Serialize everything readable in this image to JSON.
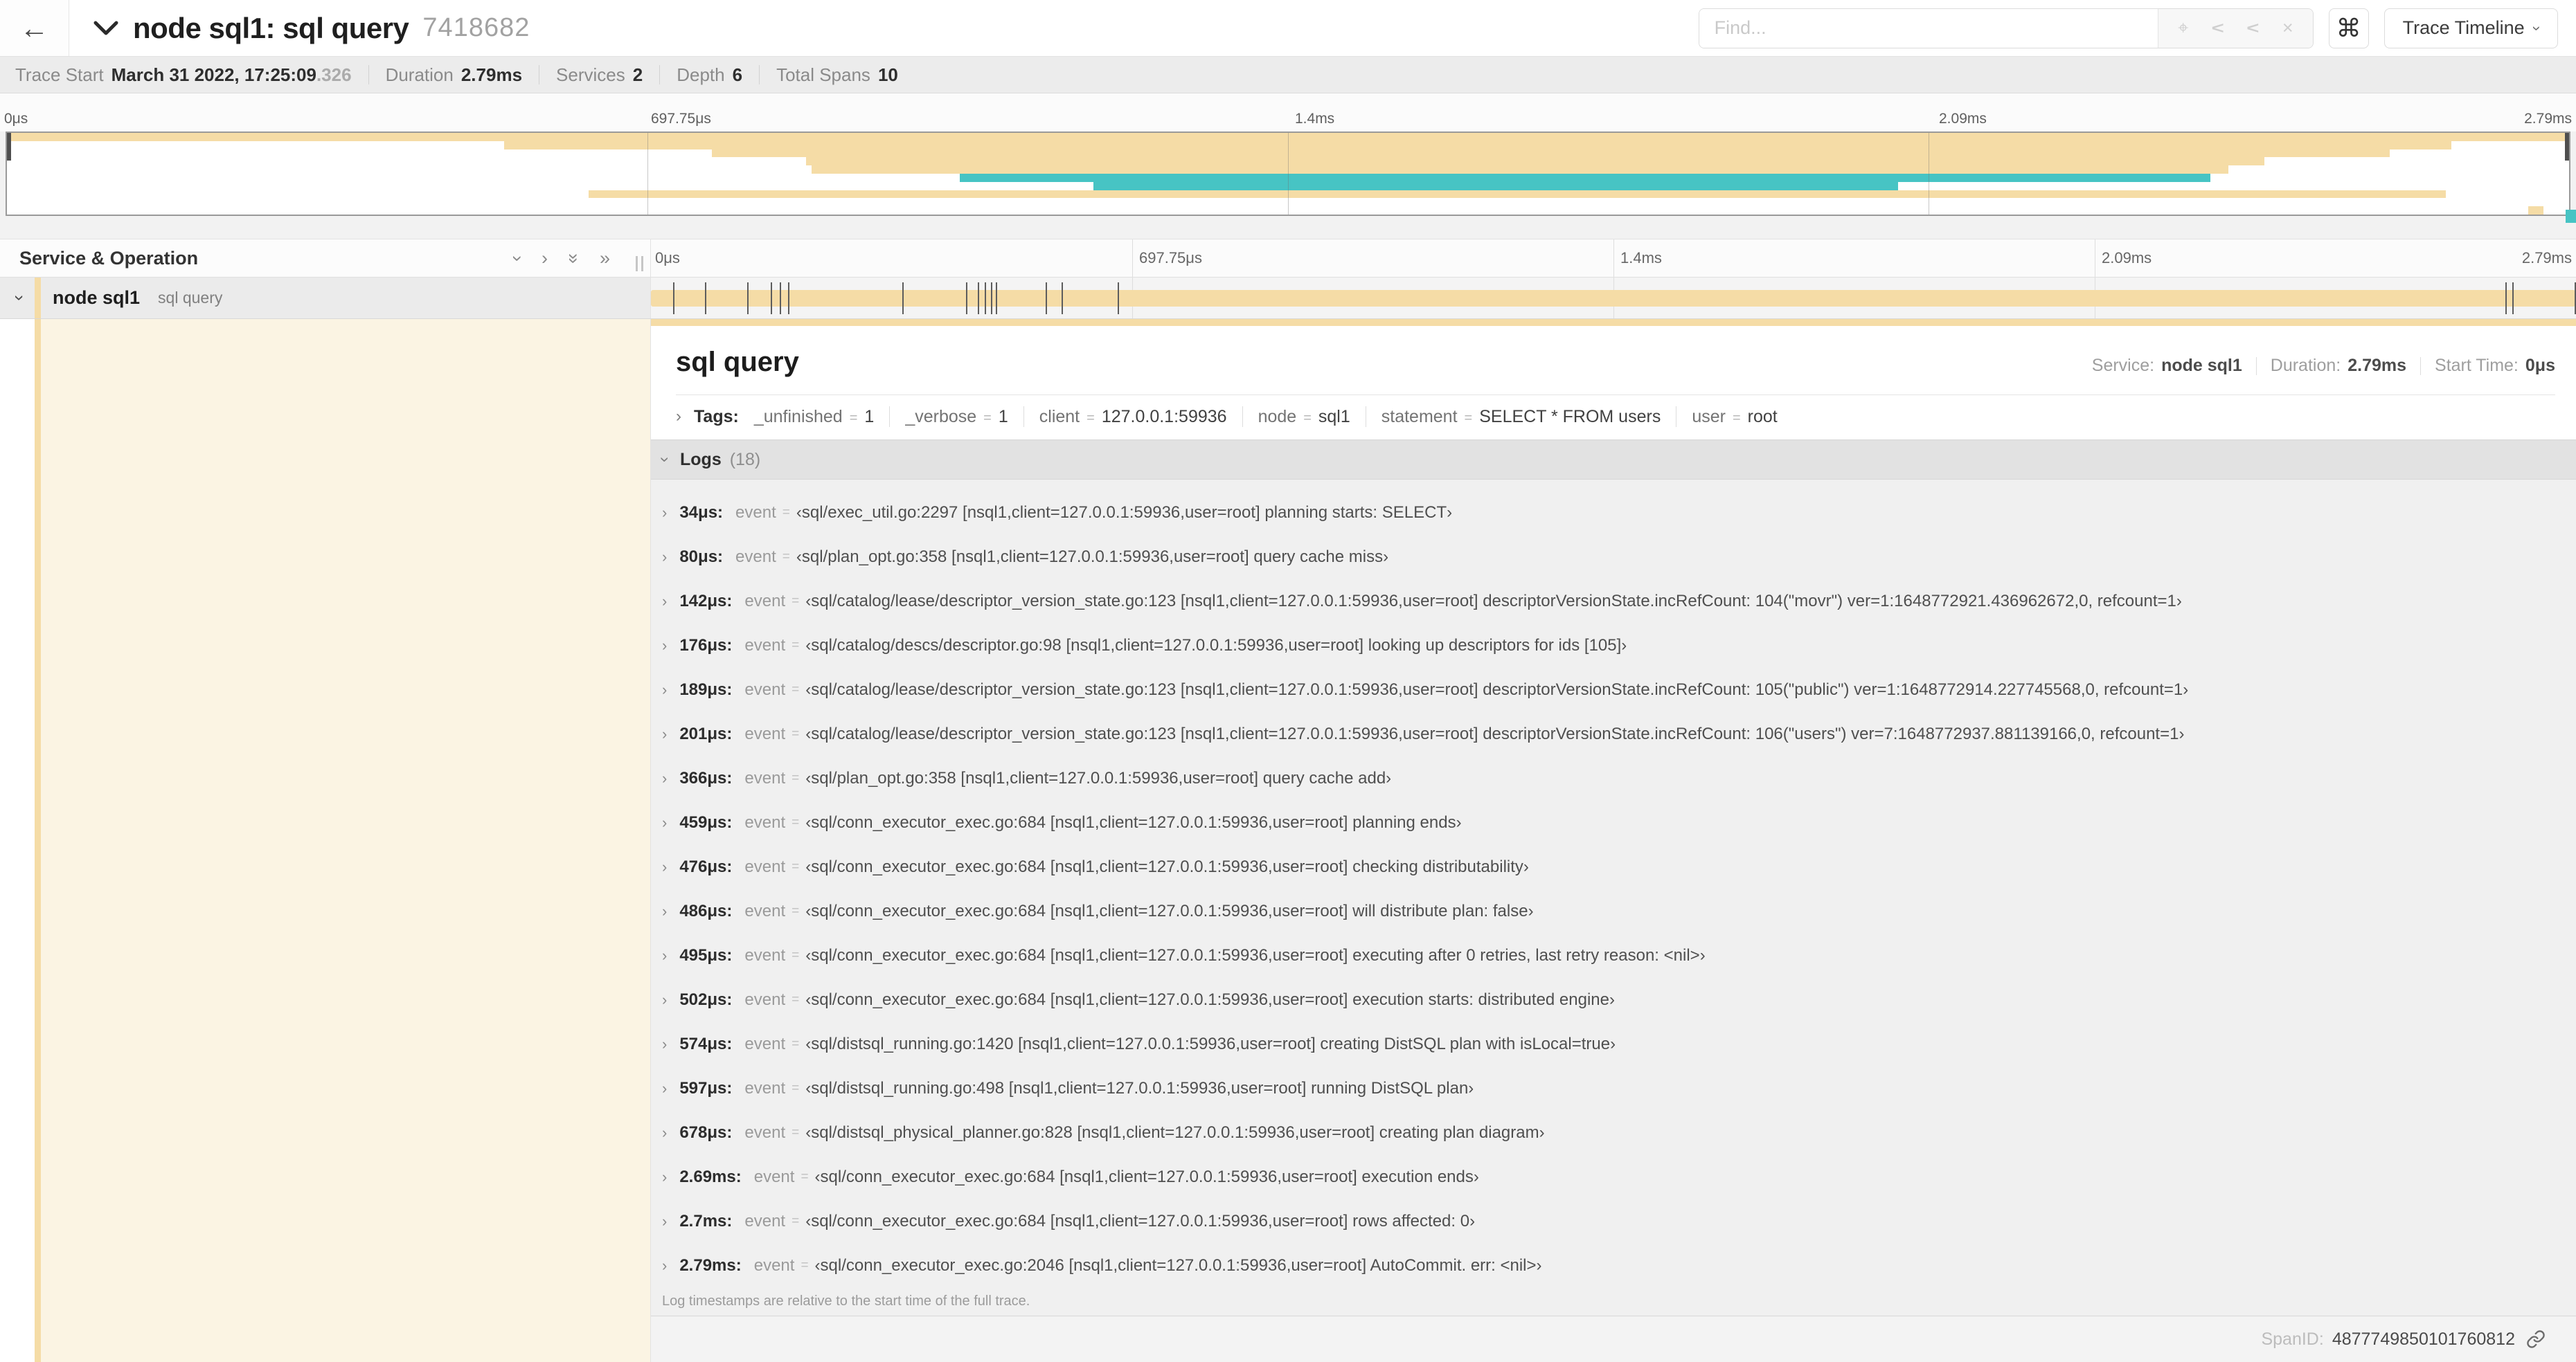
{
  "header": {
    "back_icon": "←",
    "title": "node sql1: sql query",
    "trace_id": "7418682",
    "find_placeholder": "Find...",
    "shortcut_button": "⌘",
    "view_button": "Trace Timeline"
  },
  "stats": [
    {
      "label": "Trace Start",
      "value": "March 31 2022, 17:25:09",
      "suffix": ".326"
    },
    {
      "label": "Duration",
      "value": "2.79ms"
    },
    {
      "label": "Services",
      "value": "2"
    },
    {
      "label": "Depth",
      "value": "6"
    },
    {
      "label": "Total Spans",
      "value": "10"
    }
  ],
  "ruler_ticks": [
    "0μs",
    "697.75μs",
    "1.4ms",
    "2.09ms",
    "2.79ms"
  ],
  "colors": {
    "tan": "#F5DCA6",
    "teal": "#47C4C4",
    "cream": "#FBF4E3"
  },
  "minimap_spans": [
    {
      "color": "tan",
      "start": 0,
      "end": 100
    },
    {
      "color": "tan",
      "start": 19.4,
      "end": 95.4
    },
    {
      "color": "tan",
      "start": 27.5,
      "end": 93.0
    },
    {
      "color": "tan",
      "start": 31.2,
      "end": 88.1
    },
    {
      "color": "tan",
      "start": 31.4,
      "end": 86.7
    },
    {
      "color": "teal",
      "start": 37.2,
      "end": 86.0
    },
    {
      "color": "teal",
      "start": 42.4,
      "end": 73.8
    },
    {
      "color": "tan",
      "start": 22.7,
      "end": 95.2
    },
    {
      "color": "none",
      "start": 0,
      "end": 0
    },
    {
      "color": "tan",
      "start": 98.4,
      "end": 99.0
    }
  ],
  "span_list_header": {
    "title": "Service & Operation"
  },
  "span_row": {
    "service": "node sql1",
    "operation": "sql query"
  },
  "timeline": {
    "duration_us": 2790,
    "log_marker_times_us": [
      34,
      80,
      142,
      176,
      189,
      201,
      366,
      459,
      476,
      486,
      495,
      502,
      574,
      597,
      678,
      2690,
      2700,
      2790
    ]
  },
  "detail": {
    "title": "sql query",
    "meta": [
      {
        "label": "Service:",
        "value": "node sql1"
      },
      {
        "label": "Duration:",
        "value": "2.79ms"
      },
      {
        "label": "Start Time:",
        "value": "0μs"
      }
    ],
    "tags_label": "Tags:",
    "eq": "=",
    "tags": [
      {
        "key": "_unfinished",
        "value": "1"
      },
      {
        "key": "_verbose",
        "value": "1"
      },
      {
        "key": "client",
        "value": "127.0.0.1:59936"
      },
      {
        "key": "node",
        "value": "sql1"
      },
      {
        "key": "statement",
        "value": "SELECT * FROM users"
      },
      {
        "key": "user",
        "value": "root"
      }
    ],
    "logs_label": "Logs",
    "logs_count": "(18)",
    "event_key": "event",
    "logs": [
      {
        "time": "34μs:",
        "value": "‹sql/exec_util.go:2297 [nsql1,client=127.0.0.1:59936,user=root] planning starts: SELECT›"
      },
      {
        "time": "80μs:",
        "value": "‹sql/plan_opt.go:358 [nsql1,client=127.0.0.1:59936,user=root] query cache miss›"
      },
      {
        "time": "142μs:",
        "value": "‹sql/catalog/lease/descriptor_version_state.go:123 [nsql1,client=127.0.0.1:59936,user=root] descriptorVersionState.incRefCount: 104(\"movr\") ver=1:1648772921.436962672,0, refcount=1›"
      },
      {
        "time": "176μs:",
        "value": "‹sql/catalog/descs/descriptor.go:98 [nsql1,client=127.0.0.1:59936,user=root] looking up descriptors for ids [105]›"
      },
      {
        "time": "189μs:",
        "value": "‹sql/catalog/lease/descriptor_version_state.go:123 [nsql1,client=127.0.0.1:59936,user=root] descriptorVersionState.incRefCount: 105(\"public\") ver=1:1648772914.227745568,0, refcount=1›"
      },
      {
        "time": "201μs:",
        "value": "‹sql/catalog/lease/descriptor_version_state.go:123 [nsql1,client=127.0.0.1:59936,user=root] descriptorVersionState.incRefCount: 106(\"users\") ver=7:1648772937.881139166,0, refcount=1›"
      },
      {
        "time": "366μs:",
        "value": "‹sql/plan_opt.go:358 [nsql1,client=127.0.0.1:59936,user=root] query cache add›"
      },
      {
        "time": "459μs:",
        "value": "‹sql/conn_executor_exec.go:684 [nsql1,client=127.0.0.1:59936,user=root] planning ends›"
      },
      {
        "time": "476μs:",
        "value": "‹sql/conn_executor_exec.go:684 [nsql1,client=127.0.0.1:59936,user=root] checking distributability›"
      },
      {
        "time": "486μs:",
        "value": "‹sql/conn_executor_exec.go:684 [nsql1,client=127.0.0.1:59936,user=root] will distribute plan: false›"
      },
      {
        "time": "495μs:",
        "value": "‹sql/conn_executor_exec.go:684 [nsql1,client=127.0.0.1:59936,user=root] executing after 0 retries, last retry reason: <nil>›"
      },
      {
        "time": "502μs:",
        "value": "‹sql/conn_executor_exec.go:684 [nsql1,client=127.0.0.1:59936,user=root] execution starts: distributed engine›"
      },
      {
        "time": "574μs:",
        "value": "‹sql/distsql_running.go:1420 [nsql1,client=127.0.0.1:59936,user=root] creating DistSQL plan with isLocal=true›"
      },
      {
        "time": "597μs:",
        "value": "‹sql/distsql_running.go:498 [nsql1,client=127.0.0.1:59936,user=root] running DistSQL plan›"
      },
      {
        "time": "678μs:",
        "value": "‹sql/distsql_physical_planner.go:828 [nsql1,client=127.0.0.1:59936,user=root] creating plan diagram›"
      },
      {
        "time": "2.69ms:",
        "value": "‹sql/conn_executor_exec.go:684 [nsql1,client=127.0.0.1:59936,user=root] execution ends›"
      },
      {
        "time": "2.7ms:",
        "value": "‹sql/conn_executor_exec.go:684 [nsql1,client=127.0.0.1:59936,user=root] rows affected: 0›"
      },
      {
        "time": "2.79ms:",
        "value": "‹sql/conn_executor_exec.go:2046 [nsql1,client=127.0.0.1:59936,user=root] AutoCommit. err: <nil>›"
      }
    ],
    "note": "Log timestamps are relative to the start time of the full trace.",
    "footer_label": "SpanID:",
    "footer_value": "4877749850101760812"
  },
  "icons": {
    "chevron": "›",
    "double_chevron": "»",
    "locate": "⌖",
    "clear": "×",
    "caret_items": [
      "∧",
      "∨"
    ]
  }
}
